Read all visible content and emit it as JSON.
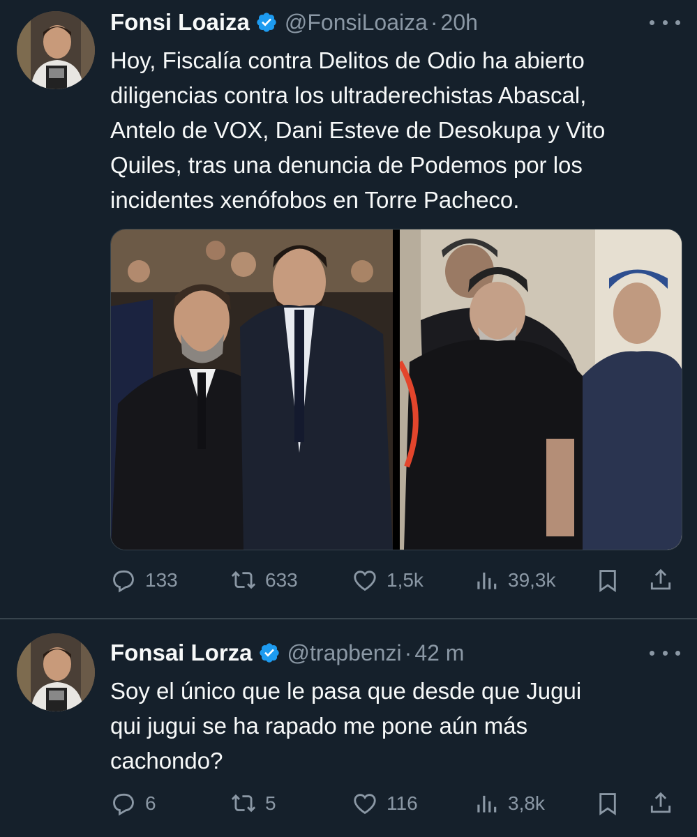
{
  "tweets": [
    {
      "name": "Fonsi Loaiza",
      "handle": "@FonsiLoaiza",
      "separator": "·",
      "time": "20h",
      "text": "Hoy, Fiscalía contra Delitos de Odio ha abierto\ndiligencias contra los ultraderechistas Abascal,\nAntelo de VOX, Dani Esteve de Desokupa y Vito\nQuiles, tras una denuncia de Podemos por los\nincidentes xenófobos en Torre Pacheco.",
      "replies": "133",
      "retweets": "633",
      "likes": "1,5k",
      "views": "39,3k"
    },
    {
      "name": "Fonsai Lorza",
      "handle": "@trapbenzi",
      "separator": "·",
      "time": "42 m",
      "text": "Soy el único que le pasa que desde que Jugui\nqui jugui se ha rapado me pone aún más\ncachondo?",
      "replies": "6",
      "retweets": "5",
      "likes": "116",
      "views": "3,8k"
    }
  ],
  "icons": {
    "verified": "verified-badge-icon",
    "more": "more-options-icon",
    "reply": "reply-icon",
    "retweet": "retweet-icon",
    "like": "heart-icon",
    "views": "views-icon",
    "bookmark": "bookmark-icon",
    "share": "share-icon"
  },
  "colors": {
    "background": "#15202b",
    "text": "#f7f9f9",
    "secondary": "#8b98a5",
    "verified": "#1d9bf0",
    "divider": "#38444d"
  }
}
